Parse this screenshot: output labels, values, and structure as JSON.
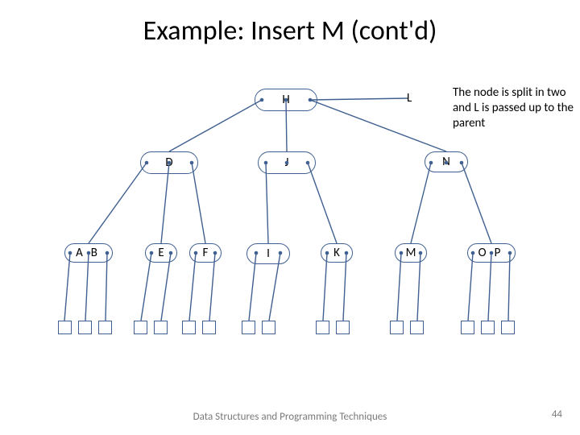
{
  "title": "Example: Insert M (cont'd)",
  "annotation": "The node is split in two and L is passed up to the parent",
  "nodes": {
    "root": "H",
    "floating_L": "L",
    "D": "D",
    "J": "J",
    "N": "N",
    "AB": "AB",
    "E": "E",
    "F": "F",
    "I": "I",
    "K": "K",
    "M": "M",
    "OP": "OP"
  },
  "footer": "Data Structures and Programming Techniques",
  "page_number": "44"
}
